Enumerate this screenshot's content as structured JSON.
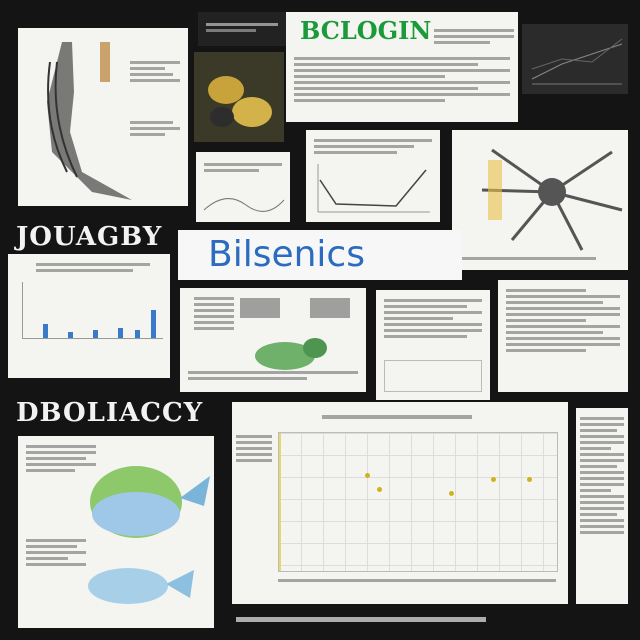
{
  "labels": {
    "top_banner": "BCLOGIN",
    "left_heading_1": "JOUAGBY",
    "center_banner": "Bilsenics",
    "left_heading_2": "DBOLIACCY"
  },
  "colors": {
    "background": "#141414",
    "banner_green": "#1a9a3a",
    "banner_blue": "#2b6cc0",
    "bar_blue": "#3a78c9",
    "point_yellow": "#d2b21a"
  },
  "icons": [
    "horse-illustration",
    "fruit-photo",
    "neuron-illustration",
    "frog-illustration",
    "fish-illustration"
  ]
}
